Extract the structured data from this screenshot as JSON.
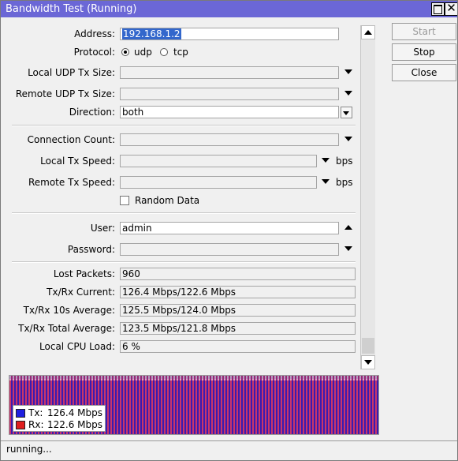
{
  "window": {
    "title": "Bandwidth Test (Running)",
    "maximize_glyph": "",
    "close_glyph": "✕"
  },
  "form": {
    "address": {
      "label": "Address:",
      "value": "192.168.1.2"
    },
    "protocol": {
      "label": "Protocol:",
      "options": [
        "udp",
        "tcp"
      ],
      "selected": "udp"
    },
    "local_udp_tx_size": {
      "label": "Local UDP Tx Size:",
      "value": ""
    },
    "remote_udp_tx_size": {
      "label": "Remote UDP Tx Size:",
      "value": ""
    },
    "direction": {
      "label": "Direction:",
      "value": "both"
    },
    "connection_count": {
      "label": "Connection Count:",
      "value": ""
    },
    "local_tx_speed": {
      "label": "Local Tx Speed:",
      "value": "",
      "unit": "bps"
    },
    "remote_tx_speed": {
      "label": "Remote Tx Speed:",
      "value": "",
      "unit": "bps"
    },
    "random_data": {
      "label": "Random Data",
      "checked": false
    },
    "user": {
      "label": "User:",
      "value": "admin"
    },
    "password": {
      "label": "Password:",
      "value": ""
    },
    "lost_packets": {
      "label": "Lost Packets:",
      "value": "960"
    },
    "txrx_current": {
      "label": "Tx/Rx Current:",
      "value": "126.4 Mbps/122.6 Mbps"
    },
    "txrx_10s_average": {
      "label": "Tx/Rx 10s Average:",
      "value": "125.5 Mbps/124.0 Mbps"
    },
    "txrx_total_average": {
      "label": "Tx/Rx Total Average:",
      "value": "123.5 Mbps/121.8 Mbps"
    },
    "local_cpu_load": {
      "label": "Local CPU Load:",
      "value": "6 %"
    }
  },
  "buttons": {
    "start": "Start",
    "stop": "Stop",
    "close": "Close"
  },
  "graph": {
    "legend": [
      {
        "key": "Tx:",
        "value": "126.4 Mbps",
        "color": "#1f1fe0"
      },
      {
        "key": "Rx:",
        "value": "122.6 Mbps",
        "color": "#e01f1f"
      }
    ]
  },
  "status": {
    "text": "running..."
  },
  "colors": {
    "titlebar": "#6b67d6",
    "selection": "#3367cc",
    "tx": "#1f1fe0",
    "rx": "#e01f1f"
  },
  "icons": [
    "scroll-up-icon",
    "scroll-down-icon",
    "dropdown-arrow-icon",
    "dropdown-up-arrow-icon"
  ]
}
